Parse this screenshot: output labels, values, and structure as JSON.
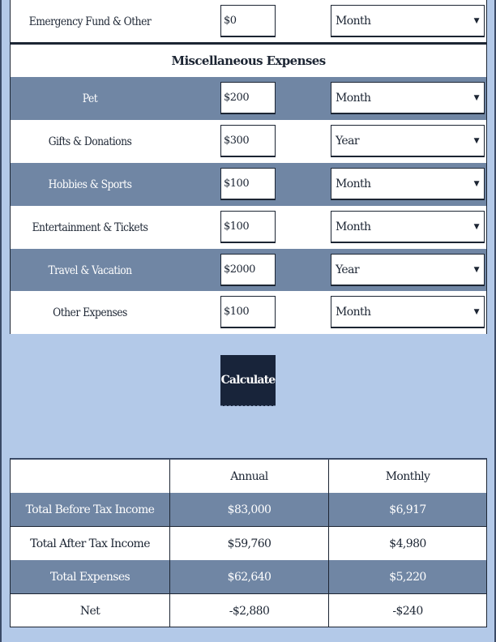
{
  "expense_rows_top": [
    {
      "label": "Emergency Fund & Other",
      "amount": "$0",
      "period": "Month"
    }
  ],
  "misc_section": {
    "title": "Miscellaneous Expenses",
    "rows": [
      {
        "label": "Pet",
        "amount": "$200",
        "period": "Month"
      },
      {
        "label": "Gifts & Donations",
        "amount": "$300",
        "period": "Year"
      },
      {
        "label": "Hobbies & Sports",
        "amount": "$100",
        "period": "Month"
      },
      {
        "label": "Entertainment & Tickets",
        "amount": "$100",
        "period": "Month"
      },
      {
        "label": "Travel & Vacation",
        "amount": "$2000",
        "period": "Year"
      },
      {
        "label": "Other Expenses",
        "amount": "$100",
        "period": "Month"
      }
    ]
  },
  "dropdown_caret": "▼",
  "calculate_button": {
    "label": "Calculate"
  },
  "results": {
    "headers": [
      "",
      "Annual",
      "Monthly"
    ],
    "rows": [
      {
        "label": "Total Before Tax Income",
        "annual": "$83,000",
        "monthly": "$6,917"
      },
      {
        "label": "Total After Tax Income",
        "annual": "$59,760",
        "monthly": "$4,980"
      },
      {
        "label": "Total Expenses",
        "annual": "$62,640",
        "monthly": "$5,220"
      },
      {
        "label": "Net",
        "annual": "-$2,880",
        "monthly": "-$240"
      }
    ]
  },
  "colors": {
    "page_background": "#b3c9e8",
    "alt_row": "#7086a4",
    "button": "#18243a",
    "text_dark": "#1c2533"
  }
}
